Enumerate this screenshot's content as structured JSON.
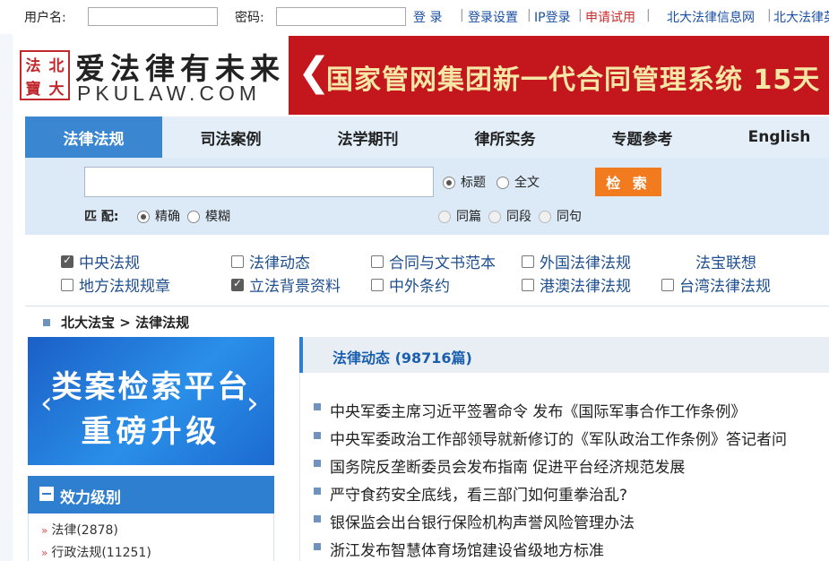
{
  "login": {
    "username_label": "用户名:",
    "password_label": "密码:",
    "login_link": "登 录",
    "sep": "|",
    "links": [
      "登录设置",
      "IP登录",
      "申请试用"
    ],
    "site_links": [
      "北大法律信息网",
      "北大法律英"
    ]
  },
  "header": {
    "seal_chars": [
      "法",
      "北",
      "寶",
      "大"
    ],
    "logo_cn": "爱法律有未来",
    "logo_en": "PKULAW.COM",
    "banner_arrow": "❮",
    "banner_text": "国家管网集团新一代合同管理系统  15天"
  },
  "nav": {
    "tabs": [
      "法律法规",
      "司法案例",
      "法学期刊",
      "律所实务",
      "专题参考",
      "English"
    ],
    "active": "法律法规"
  },
  "search": {
    "input_value": "",
    "scope_options": [
      "标题",
      "全文"
    ],
    "scope_selected": "标题",
    "button_label": "检 索",
    "match_label": "匹 配:",
    "match_options": [
      "精确",
      "模糊"
    ],
    "match_selected": "精确",
    "proximity_options": [
      "同篇",
      "同段",
      "同句"
    ]
  },
  "categories": {
    "items": [
      {
        "label": "中央法规",
        "checked": true
      },
      {
        "label": "法律动态",
        "checked": false
      },
      {
        "label": "合同与文书范本",
        "checked": false
      },
      {
        "label": "外国法律法规",
        "checked": false
      },
      {
        "label": "地方法规规章",
        "checked": false
      },
      {
        "label": "立法背景资料",
        "checked": true
      },
      {
        "label": "中外条约",
        "checked": false
      },
      {
        "label": "港澳法律法规",
        "checked": false
      },
      {
        "label": "台湾法律法规",
        "checked": false
      }
    ],
    "extra_link": "法宝联想"
  },
  "breadcrumb": {
    "root": "北大法宝",
    "arrow": ">",
    "current": "法律法规"
  },
  "promo": {
    "line1": "类案检索平台",
    "line2": "重磅升级",
    "prev": "‹",
    "next": "›"
  },
  "effect_level": {
    "title": "效力级别",
    "items": [
      "法律(2878)",
      "行政法规(11251)"
    ]
  },
  "news": {
    "title": "法律动态 (98716篇)",
    "items": [
      "中央军委主席习近平签署命令 发布《国际军事合作工作条例》",
      "中央军委政治工作部领导就新修订的《军队政治工作条例》答记者问",
      "国务院反垄断委员会发布指南 促进平台经济规范发展",
      "严守食药安全底线，看三部门如何重拳治乱?",
      "银保监会出台银行保险机构声誉风险管理办法",
      "浙江发布智慧体育场馆建设省级地方标准"
    ]
  }
}
